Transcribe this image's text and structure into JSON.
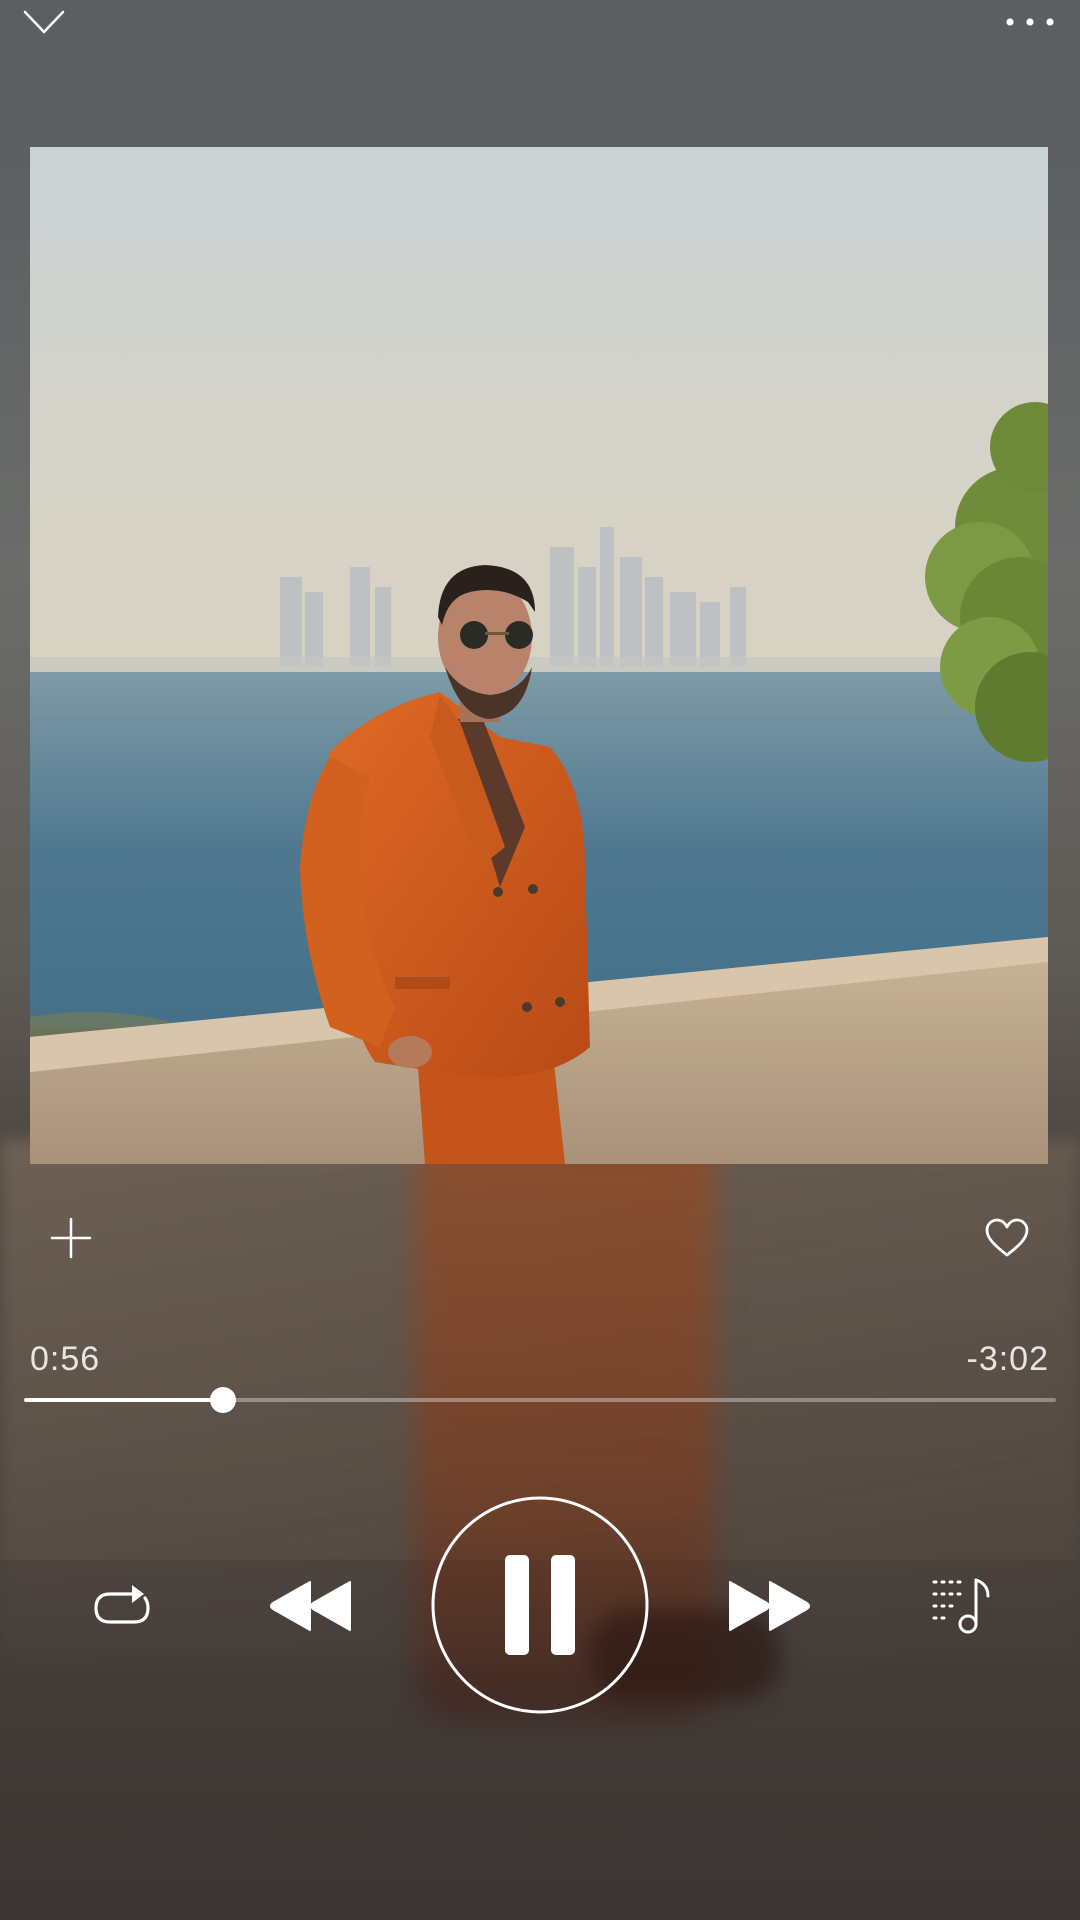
{
  "player": {
    "elapsed": "0:56",
    "remaining": "-3:02",
    "progress_fraction": 0.193,
    "state": "playing"
  },
  "icons": {
    "top_left": "chevron-down-icon",
    "top_right": "more-dots-icon",
    "add": "plus-icon",
    "like": "heart-icon",
    "repeat": "repeat-icon",
    "rewind": "rewind-icon",
    "play_pause": "pause-icon",
    "forward": "fast-forward-icon",
    "queue": "playlist-icon"
  },
  "colors": {
    "foreground": "#ffffff",
    "suit": "#d2601f"
  }
}
